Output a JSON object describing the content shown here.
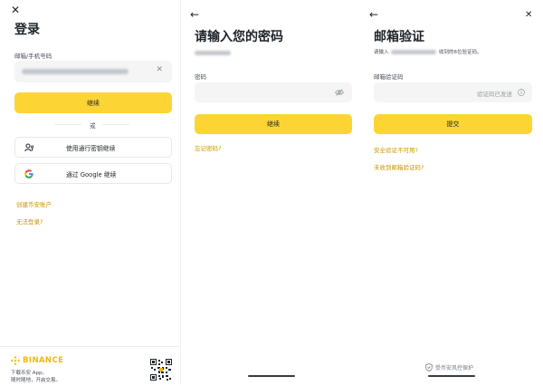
{
  "login": {
    "close_icon": "✕",
    "title": "登录",
    "account_label": "邮箱/手机号码",
    "clear_icon": "✕",
    "continue_label": "继续",
    "or_label": "或",
    "passkey_label": "使用通行密钥继续",
    "google_label": "通过 Google 继续",
    "create_account_label": "创建币安账户",
    "cant_login_label": "无法登录?",
    "brand_name": "BINANCE",
    "download_line1": "下载币安 App。",
    "download_line2": "随时随地，开启交易。"
  },
  "password": {
    "back_icon": "←",
    "title": "请输入您的密码",
    "password_label": "密码",
    "continue_label": "继续",
    "forgot_label": "忘记密码?"
  },
  "verify": {
    "back_icon": "←",
    "close_icon": "✕",
    "title": "邮箱验证",
    "desc_prefix": "请输入",
    "desc_suffix": "收到的6位验证码。",
    "code_label": "邮箱验证码",
    "code_sent_label": "验证码已发送",
    "submit_label": "提交",
    "security_unavailable_label": "安全验证不可用?",
    "no_email_label": "未收到邮箱验证码?",
    "protect_label": "受币安风控保护"
  },
  "colors": {
    "accent": "#fcd535",
    "link": "#c99400",
    "input_bg": "#f5f5f5"
  }
}
